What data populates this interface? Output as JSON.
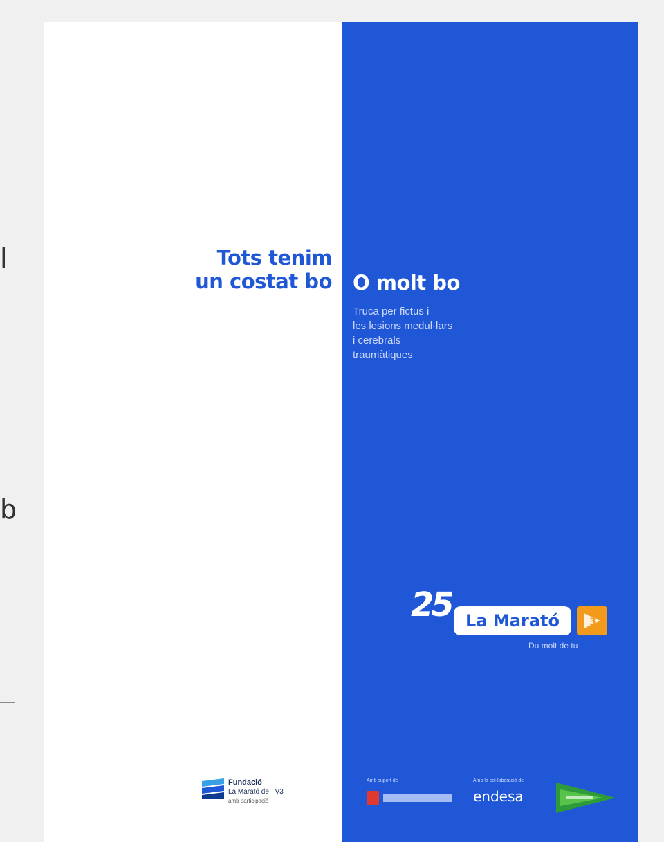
{
  "background_fragments": [
    "l",
    "b"
  ],
  "poster": {
    "tagline_left": [
      "Tots tenim",
      "un costat bo"
    ],
    "tagline_right": "O molt bo",
    "subtext": [
      "Truca per fictus i",
      "les lesions medul·lars",
      "i cerebrals",
      "traumàtiques"
    ],
    "brand_blue": "#1f57d6",
    "logo": {
      "number": "25",
      "name": "La Marató",
      "slogan": "Du molt de tu",
      "icon": "tv3-logo"
    },
    "sponsors": {
      "fundacio_name": "Fundació",
      "fundacio_sub": "La Marató de TV3",
      "fundacio_sub2": "amb participació",
      "caption_1": "Amb suport de",
      "caption_2": "Amb la col·laboració de",
      "endesa": "endesa",
      "icons": [
        "generalitat-logo",
        "el-corte-ingles-logo"
      ]
    }
  }
}
